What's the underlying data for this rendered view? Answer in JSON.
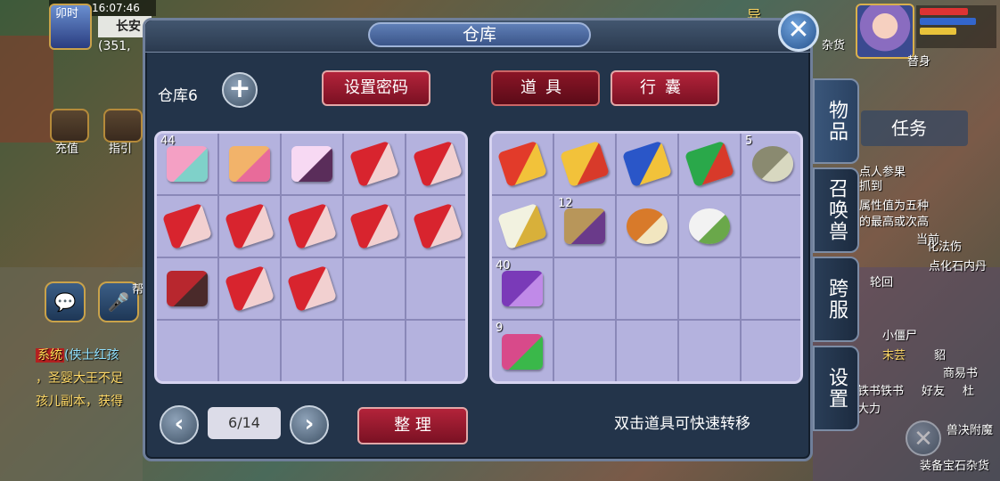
{
  "hud": {
    "time_label": "卯时",
    "clock": "16:07:46",
    "location": "长安",
    "coords": "(351,",
    "recharge_label": "充值",
    "guide_label": "指引",
    "chat_help_label": "帮",
    "sys_tag": "系统",
    "sys_line1": "(侠士红孩",
    "sys_line2": "，圣婴大王不足",
    "sys_line3": "孩儿副本，获得"
  },
  "right_hud": {
    "task_tab": "任务",
    "texts": [
      "异",
      "杂货",
      "替身",
      "点人参果",
      "抓到",
      "属性值为五种",
      "的最高或次高",
      "当前",
      "点化石内丹",
      "化法伤",
      "轮回",
      "小僵尸",
      "末芸",
      "貂",
      "商易书",
      "铁书铁书",
      "好友",
      "杜",
      "大力",
      "兽决附魔",
      "装备宝石杂货"
    ]
  },
  "window": {
    "title": "仓库",
    "storage_label": "仓库6",
    "set_password": "设置密码",
    "tab_items": "道具",
    "tab_bag": "行囊",
    "page_indicator": "6/14",
    "sort_button": "整 理",
    "hint": "双击道具可快速转移"
  },
  "side_tabs": {
    "items": "物品",
    "pets": "召唤兽",
    "cross_server": "跨服",
    "settings": "设置"
  },
  "storage_grid": [
    {
      "icon": "pink-pig-bag-icon",
      "qty": "44"
    },
    {
      "icon": "lucky-bag-icon",
      "qty": ""
    },
    {
      "icon": "portrait-card-icon",
      "qty": ""
    },
    {
      "icon": "red-scroll-icon",
      "qty": ""
    },
    {
      "icon": "red-scroll-icon",
      "qty": ""
    },
    {
      "icon": "red-scroll-icon",
      "qty": ""
    },
    {
      "icon": "red-scroll-icon",
      "qty": ""
    },
    {
      "icon": "red-scroll-icon",
      "qty": ""
    },
    {
      "icon": "red-scroll-icon",
      "qty": ""
    },
    {
      "icon": "red-scroll-icon",
      "qty": ""
    },
    {
      "icon": "red-map-icon",
      "qty": ""
    },
    {
      "icon": "red-scroll-icon",
      "qty": ""
    },
    {
      "icon": "red-scroll-icon",
      "qty": ""
    },
    {
      "icon": "",
      "qty": ""
    },
    {
      "icon": "",
      "qty": ""
    },
    {
      "icon": "",
      "qty": ""
    },
    {
      "icon": "",
      "qty": ""
    },
    {
      "icon": "",
      "qty": ""
    },
    {
      "icon": "",
      "qty": ""
    },
    {
      "icon": "",
      "qty": ""
    }
  ],
  "bag_grid": [
    {
      "icon": "red-flag-icon",
      "qty": ""
    },
    {
      "icon": "yellow-flag-icon",
      "qty": ""
    },
    {
      "icon": "blue-flag-icon",
      "qty": ""
    },
    {
      "icon": "multi-flag-icon",
      "qty": ""
    },
    {
      "icon": "stone-drum-icon",
      "qty": "5"
    },
    {
      "icon": "white-flag-icon",
      "qty": ""
    },
    {
      "icon": "book-crate-icon",
      "qty": "12"
    },
    {
      "icon": "food-bowl-icon",
      "qty": ""
    },
    {
      "icon": "tea-bowl-icon",
      "qty": ""
    },
    {
      "icon": "",
      "qty": ""
    },
    {
      "icon": "purple-herb-icon",
      "qty": "40"
    },
    {
      "icon": "",
      "qty": ""
    },
    {
      "icon": "",
      "qty": ""
    },
    {
      "icon": "",
      "qty": ""
    },
    {
      "icon": "",
      "qty": ""
    },
    {
      "icon": "gift-box-icon",
      "qty": "9"
    },
    {
      "icon": "",
      "qty": ""
    },
    {
      "icon": "",
      "qty": ""
    },
    {
      "icon": "",
      "qty": ""
    },
    {
      "icon": "",
      "qty": ""
    }
  ]
}
